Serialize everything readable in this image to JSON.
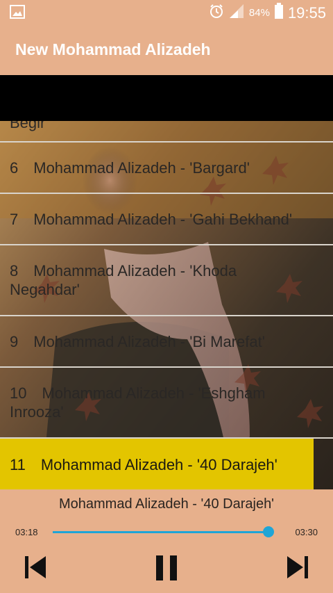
{
  "status_bar": {
    "battery_percent": "84%",
    "time": "19:55",
    "icons": [
      "image-icon",
      "alarm-icon",
      "signal-icon",
      "battery-icon"
    ]
  },
  "app_bar": {
    "title": "New Mohammad Alizadeh"
  },
  "list": {
    "partial_item_text": "Begir",
    "items": [
      {
        "num": "6",
        "text": "Mohammad Alizadeh - 'Bargard'"
      },
      {
        "num": "7",
        "text": "Mohammad Alizadeh - 'Gahi Bekhand'"
      },
      {
        "num": "8",
        "text": "Mohammad Alizadeh - 'Khoda",
        "text2": "Negahdar'"
      },
      {
        "num": "9",
        "text": "Mohammad Alizadeh - 'Bi Marefat'"
      },
      {
        "num": "10",
        "text": "Mohammad Alizadeh - 'Eshgham",
        "text2": "Inrooza'"
      },
      {
        "num": "11",
        "text": "Mohammad Alizadeh - '40 Darajeh'",
        "selected": true
      }
    ]
  },
  "player": {
    "now_playing": "Mohammad Alizadeh - '40 Darajeh'",
    "elapsed": "03:18",
    "duration": "03:30",
    "progress_fraction": 0.985,
    "accent_color": "#1fa5d6",
    "controls": [
      "previous-icon",
      "pause-icon",
      "next-icon"
    ]
  }
}
